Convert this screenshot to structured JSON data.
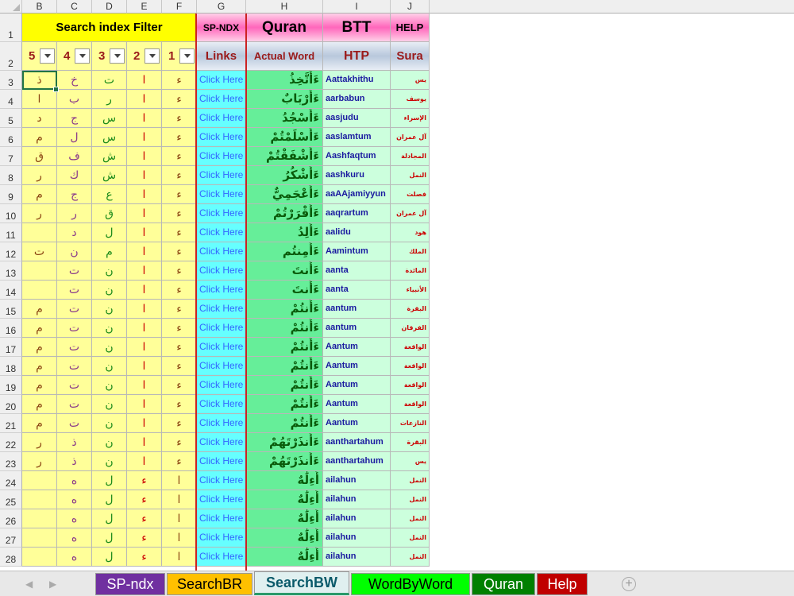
{
  "columns": [
    "B",
    "C",
    "D",
    "E",
    "F",
    "G",
    "H",
    "I",
    "J"
  ],
  "header_row1": {
    "search_filter": "Search index Filter",
    "sp_ndx": "SP-NDX",
    "quran": "Quran",
    "btt": "BTT",
    "help": "HELP"
  },
  "header_row2": {
    "filters": [
      "5",
      "4",
      "3",
      "2",
      "1"
    ],
    "links": "Links",
    "actual_word": "Actual Word",
    "htp": "HTP",
    "sura": "Sura"
  },
  "row_numbers": [
    "1",
    "2",
    "3",
    "4",
    "5",
    "6",
    "7",
    "8",
    "9",
    "10",
    "11",
    "12",
    "13",
    "14",
    "15",
    "16",
    "17",
    "18",
    "19",
    "20",
    "21",
    "22",
    "23",
    "24",
    "25",
    "26",
    "27",
    "28"
  ],
  "rows": [
    {
      "b": "ذ",
      "c": "خ",
      "d": "ت",
      "e": "ا",
      "f": "ء",
      "link": "Click Here",
      "word": "ءَأَتَّخِذُ",
      "htp": "Aattakhithu",
      "sura": "يس"
    },
    {
      "b": "ا",
      "c": "ب",
      "d": "ر",
      "e": "ا",
      "f": "ء",
      "link": "Click Here",
      "word": "ءَأَرْبَابٌ",
      "htp": "aarbabun",
      "sura": "يوسف"
    },
    {
      "b": "د",
      "c": "ج",
      "d": "س",
      "e": "ا",
      "f": "ء",
      "link": "Click Here",
      "word": "ءَأَسْجُدُ",
      "htp": "aasjudu",
      "sura": "الإسراء"
    },
    {
      "b": "م",
      "c": "ل",
      "d": "س",
      "e": "ا",
      "f": "ء",
      "link": "Click Here",
      "word": "ءَأَسْلَمْتُمْ",
      "htp": "aaslamtum",
      "sura": "آل عمران"
    },
    {
      "b": "ق",
      "c": "ف",
      "d": "ش",
      "e": "ا",
      "f": "ء",
      "link": "Click Here",
      "word": "ءَأَشْفَقْتُمْ",
      "htp": "Aashfaqtum",
      "sura": "المجادلة"
    },
    {
      "b": "ر",
      "c": "ك",
      "d": "ش",
      "e": "ا",
      "f": "ء",
      "link": "Click Here",
      "word": "ءَأَشْكُرُ",
      "htp": "aashkuru",
      "sura": "النمل"
    },
    {
      "b": "م",
      "c": "ج",
      "d": "ع",
      "e": "ا",
      "f": "ء",
      "link": "Click Here",
      "word": "ءَأَعْجَمِيٌّ",
      "htp": "aaAAjamiyyun",
      "sura": "فصلت"
    },
    {
      "b": "ر",
      "c": "ر",
      "d": "ق",
      "e": "ا",
      "f": "ء",
      "link": "Click Here",
      "word": "ءَأَقْرَرْتُمْ",
      "htp": "aaqrartum",
      "sura": "آل عمران"
    },
    {
      "b": "",
      "c": "د",
      "d": "ل",
      "e": "ا",
      "f": "ء",
      "link": "Click Here",
      "word": "ءَأَلِدُ",
      "htp": "aalidu",
      "sura": "هود"
    },
    {
      "b": "ت",
      "c": "ن",
      "d": "م",
      "e": "ا",
      "f": "ء",
      "link": "Click Here",
      "word": "ءَأَمِنتُم",
      "htp": "Aamintum",
      "sura": "الملك"
    },
    {
      "b": "",
      "c": "ت",
      "d": "ن",
      "e": "ا",
      "f": "ء",
      "link": "Click Here",
      "word": "ءَأَنتَ",
      "htp": "aanta",
      "sura": "المائدة"
    },
    {
      "b": "",
      "c": "ت",
      "d": "ن",
      "e": "ا",
      "f": "ء",
      "link": "Click Here",
      "word": "ءَأَنتَ",
      "htp": "aanta",
      "sura": "الأنبياء"
    },
    {
      "b": "م",
      "c": "ت",
      "d": "ن",
      "e": "ا",
      "f": "ء",
      "link": "Click Here",
      "word": "ءَأَنتُمْ",
      "htp": "aantum",
      "sura": "البقرة"
    },
    {
      "b": "م",
      "c": "ت",
      "d": "ن",
      "e": "ا",
      "f": "ء",
      "link": "Click Here",
      "word": "ءَأَنتُمْ",
      "htp": "aantum",
      "sura": "الفرقان"
    },
    {
      "b": "م",
      "c": "ت",
      "d": "ن",
      "e": "ا",
      "f": "ء",
      "link": "Click Here",
      "word": "ءَأَنتُمْ",
      "htp": "Aantum",
      "sura": "الواقعة"
    },
    {
      "b": "م",
      "c": "ت",
      "d": "ن",
      "e": "ا",
      "f": "ء",
      "link": "Click Here",
      "word": "ءَأَنتُمْ",
      "htp": "Aantum",
      "sura": "الواقعة"
    },
    {
      "b": "م",
      "c": "ت",
      "d": "ن",
      "e": "ا",
      "f": "ء",
      "link": "Click Here",
      "word": "ءَأَنتُمْ",
      "htp": "Aantum",
      "sura": "الواقعة"
    },
    {
      "b": "م",
      "c": "ت",
      "d": "ن",
      "e": "ا",
      "f": "ء",
      "link": "Click Here",
      "word": "ءَأَنتُمْ",
      "htp": "Aantum",
      "sura": "الواقعة"
    },
    {
      "b": "م",
      "c": "ت",
      "d": "ن",
      "e": "ا",
      "f": "ء",
      "link": "Click Here",
      "word": "ءَأَنتُمْ",
      "htp": "Aantum",
      "sura": "النازعات"
    },
    {
      "b": "ر",
      "c": "ذ",
      "d": "ن",
      "e": "ا",
      "f": "ء",
      "link": "Click Here",
      "word": "ءَأَنذَرْتَهُمْ",
      "htp": "aanthartahum",
      "sura": "البقرة"
    },
    {
      "b": "ر",
      "c": "ذ",
      "d": "ن",
      "e": "ا",
      "f": "ء",
      "link": "Click Here",
      "word": "ءَأَنذَرْتَهُمْ",
      "htp": "aanthartahum",
      "sura": "يس"
    },
    {
      "b": "",
      "c": "ه",
      "d": "ل",
      "e": "ء",
      "f": "ا",
      "link": "Click Here",
      "word": "أَءِلَٰهٌ",
      "htp": "ailahun",
      "sura": "النمل"
    },
    {
      "b": "",
      "c": "ه",
      "d": "ل",
      "e": "ء",
      "f": "ا",
      "link": "Click Here",
      "word": "أَءِلَٰهٌ",
      "htp": "ailahun",
      "sura": "النمل"
    },
    {
      "b": "",
      "c": "ه",
      "d": "ل",
      "e": "ء",
      "f": "ا",
      "link": "Click Here",
      "word": "أَءِلَٰهٌ",
      "htp": "ailahun",
      "sura": "النمل"
    },
    {
      "b": "",
      "c": "ه",
      "d": "ل",
      "e": "ء",
      "f": "ا",
      "link": "Click Here",
      "word": "أَءِلَٰهٌ",
      "htp": "ailahun",
      "sura": "النمل"
    },
    {
      "b": "",
      "c": "ه",
      "d": "ل",
      "e": "ء",
      "f": "ا",
      "link": "Click Here",
      "word": "أَءِلَٰهٌ",
      "htp": "ailahun",
      "sura": "النمل"
    }
  ],
  "sheet_tabs": [
    {
      "label": "SP-ndx",
      "bg": "#7030a0",
      "fg": "#ffffff"
    },
    {
      "label": "SearchBR",
      "bg": "#ffc000",
      "fg": "#000000"
    },
    {
      "label": "SearchBW",
      "bg": "#e0f0f0",
      "fg": "#0a5a6a",
      "active": true
    },
    {
      "label": "WordByWord",
      "bg": "#00ff00",
      "fg": "#000000"
    },
    {
      "label": "Quran",
      "bg": "#008000",
      "fg": "#ffffff"
    },
    {
      "label": "Help",
      "bg": "#c00000",
      "fg": "#ffffff"
    }
  ],
  "colors": {
    "yellow": "#ffff99",
    "cyan": "#66ffff",
    "green": "#66ee99",
    "light_green": "#ccffdd",
    "pink": "#ff66bb"
  }
}
